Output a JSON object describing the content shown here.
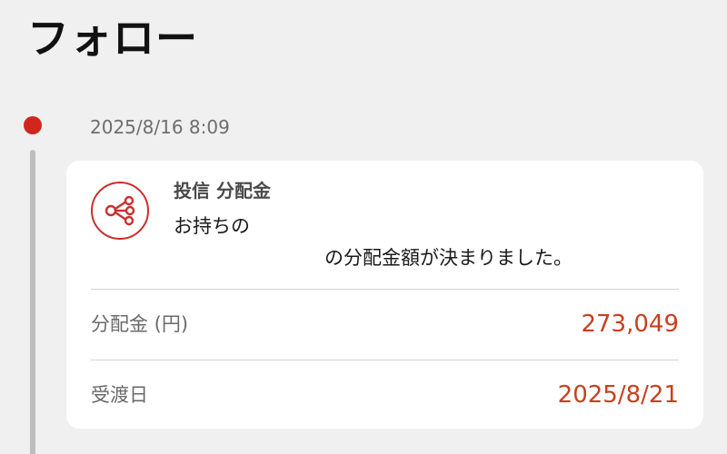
{
  "page": {
    "title": "フォロー"
  },
  "timeline": {
    "timestamp": "2025/8/16 8:09",
    "accent_color": "#d0271d"
  },
  "card": {
    "icon": "share-network-icon",
    "title": "投信 分配金",
    "message_prefix": "お持ちの",
    "message_suffix": "の分配金額が決まりました。",
    "rows": [
      {
        "label": "分配金 (円)",
        "value": "273,049"
      },
      {
        "label": "受渡日",
        "value": "2025/8/21"
      }
    ],
    "value_color": "#c8401f"
  }
}
